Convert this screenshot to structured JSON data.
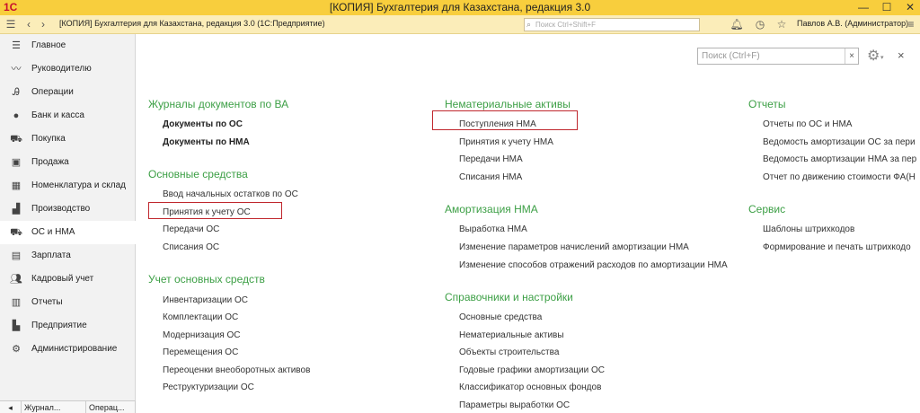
{
  "window": {
    "title": "[КОПИЯ] Бухгалтерия для Казахстана, редакция 3.0",
    "logo": "1С",
    "app_title": "[КОПИЯ] Бухгалтерия для Казахстана, редакция 3.0  (1С:Предприятие)",
    "search_placeholder": "Поиск Ctrl+Shift+F",
    "user": "Павлов А.В. (Администратор)"
  },
  "sidebar": {
    "items": [
      {
        "label": "Главное",
        "icon": "menu-icon"
      },
      {
        "label": "Руководителю",
        "icon": "chart-line-icon"
      },
      {
        "label": "Операции",
        "icon": "operations-icon"
      },
      {
        "label": "Банк и касса",
        "icon": "coin-icon"
      },
      {
        "label": "Покупка",
        "icon": "cart-icon"
      },
      {
        "label": "Продажа",
        "icon": "bag-icon"
      },
      {
        "label": "Номенклатура и склад",
        "icon": "warehouse-icon"
      },
      {
        "label": "Производство",
        "icon": "factory-icon"
      },
      {
        "label": "ОС и НМА",
        "icon": "truck-icon"
      },
      {
        "label": "Зарплата",
        "icon": "salary-icon"
      },
      {
        "label": "Кадровый учет",
        "icon": "people-icon"
      },
      {
        "label": "Отчеты",
        "icon": "bar-chart-icon"
      },
      {
        "label": "Предприятие",
        "icon": "building-icon"
      },
      {
        "label": "Администрирование",
        "icon": "gear-icon"
      }
    ],
    "active_index": 8,
    "bottom_tabs": [
      "Журнал...",
      "Операц..."
    ]
  },
  "main": {
    "search_placeholder": "Поиск (Ctrl+F)",
    "clear": "×",
    "close": "×",
    "col1": {
      "journals_title": "Журналы документов по ВА",
      "journals": [
        "Документы по ОС",
        "Документы по НМА"
      ],
      "fixed_assets_title": "Основные средства",
      "fixed_assets": [
        "Ввод начальных остатков по ОС",
        "Принятия к учету ОС",
        "Передачи ОС",
        "Списания ОС"
      ],
      "accounting_title": "Учет основных средств",
      "accounting": [
        "Инвентаризации ОС",
        "Комплектации ОС",
        "Модернизация ОС",
        "Перемещения ОС",
        "Переоценки внеоборотных активов",
        "Реструктуризации ОС"
      ]
    },
    "col2": {
      "intangible_title": "Нематериальные активы",
      "intangible": [
        "Поступления НМА",
        "Принятия к учету НМА",
        "Передачи НМА",
        "Списания НМА"
      ],
      "amortization_title": "Амортизация НМА",
      "amortization": [
        "Выработка НМА",
        "Изменение параметров начислений амортизации НМА",
        "Изменение способов отражений расходов по амортизации НМА"
      ],
      "refs_title": "Справочники и настройки",
      "refs": [
        "Основные средства",
        "Нематериальные активы",
        "Объекты строительства",
        "Годовые графики амортизации ОС",
        "Классификатор основных фондов",
        "Параметры выработки ОС"
      ]
    },
    "col3": {
      "reports_title": "Отчеты",
      "reports": [
        "Отчеты по ОС и НМА",
        "Ведомость амортизации ОС за пери",
        "Ведомость амортизации НМА за пер",
        "Отчет по движению стоимости ФА(Н"
      ],
      "service_title": "Сервис",
      "service": [
        "Шаблоны штрихкодов",
        "Формирование и печать штрихкодо"
      ]
    }
  },
  "colors": {
    "titlebar": "#f8ce3d",
    "toolbar": "#fbedb9",
    "section_heading": "#3c9f45",
    "highlight_box": "#c0272d"
  }
}
